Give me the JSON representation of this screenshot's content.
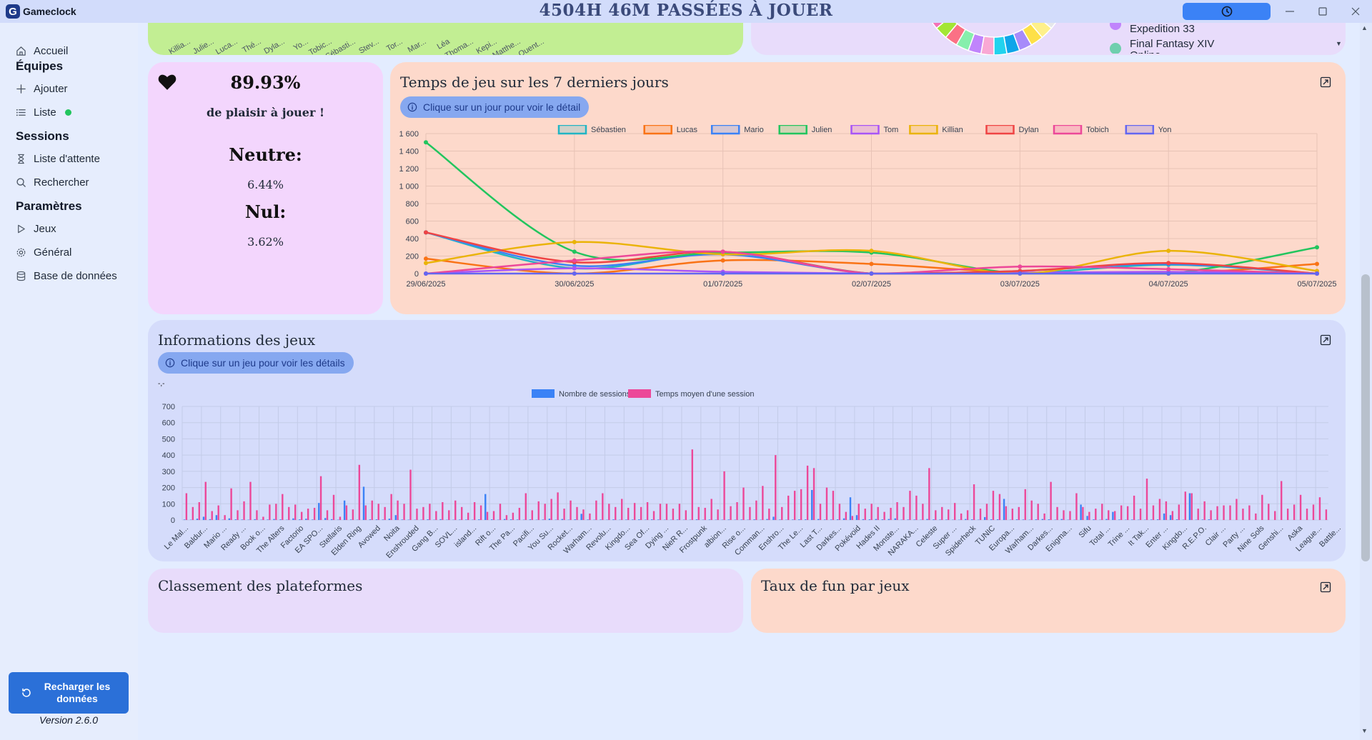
{
  "app": {
    "name": "Gameclock",
    "logo_letter": "G",
    "headline": "4504H 46M PASSÉES À JOUER"
  },
  "window": {
    "timer_icon": "clock-icon",
    "minimize": "—",
    "maximize": "☐",
    "close": "✕"
  },
  "sidebar": {
    "home": "Accueil",
    "teams_heading": "Équipes",
    "add": "Ajouter",
    "list": "Liste",
    "sessions_heading": "Sessions",
    "waitlist": "Liste d'attente",
    "search": "Rechercher",
    "settings_heading": "Paramètres",
    "games": "Jeux",
    "general": "Général",
    "database": "Base de données",
    "reload": "Recharger les données",
    "version": "Version 2.6.0"
  },
  "top_cards": {
    "names_row": [
      "Killia...",
      "Julie...",
      "Luca...",
      "Thé...",
      "Dyla...",
      "Yo...",
      "Tobic...",
      "Sébasti...",
      "Stev...",
      "Tor...",
      "Mar...",
      "Léa",
      "Thoma...",
      "Kepi...",
      "Matthe...",
      "Quent..."
    ],
    "legend_items": [
      "Expedition 33",
      "Final Fantasy XIV Online"
    ],
    "legend_colors": [
      "#c084fc",
      "#6fcfae"
    ]
  },
  "fun": {
    "percent": "89.93%",
    "caption": "de plaisir à jouer !",
    "neutral_label": "Neutre:",
    "neutral_value": "6.44%",
    "null_label": "Nul:",
    "null_value": "3.62%"
  },
  "week_chart": {
    "title": "Temps de jeu sur les 7 derniers jours",
    "hint": "Clique sur un jour pour voir le détail"
  },
  "games_chart": {
    "title": "Informations des jeux",
    "hint": "Clique sur un jeu pour voir les détails",
    "tiny_label": "-,-"
  },
  "bottom_cards": {
    "platforms_title": "Classement des plateformes",
    "fun_rate_title": "Taux de fun par jeux"
  },
  "chart_data": [
    {
      "type": "line",
      "title": "Temps de jeu sur les 7 derniers jours",
      "categories": [
        "29/06/2025",
        "30/06/2025",
        "01/07/2025",
        "02/07/2025",
        "03/07/2025",
        "04/07/2025",
        "05/07/2025"
      ],
      "ylim": [
        0,
        1600
      ],
      "yticks": [
        0,
        200,
        400,
        600,
        800,
        1000,
        1200,
        1400,
        1600
      ],
      "ytick_labels": [
        "0",
        "200",
        "400",
        "600",
        "800",
        "1 000",
        "1 200",
        "1 400",
        "1 600"
      ],
      "legend_position": "top",
      "grid": true,
      "series": [
        {
          "name": "Sébastien",
          "color": "#22b5c4",
          "values": [
            470,
            60,
            240,
            0,
            0,
            100,
            0
          ]
        },
        {
          "name": "Lucas",
          "color": "#f97316",
          "values": [
            170,
            0,
            150,
            110,
            10,
            0,
            110
          ]
        },
        {
          "name": "Mario",
          "color": "#3b82f6",
          "values": [
            470,
            90,
            220,
            0,
            30,
            110,
            0
          ]
        },
        {
          "name": "Julien",
          "color": "#22c55e",
          "values": [
            1500,
            250,
            240,
            240,
            0,
            0,
            300
          ]
        },
        {
          "name": "Tom",
          "color": "#a855f7",
          "values": [
            0,
            60,
            20,
            0,
            10,
            20,
            0
          ]
        },
        {
          "name": "Killian",
          "color": "#eab308",
          "values": [
            120,
            360,
            220,
            260,
            0,
            260,
            30
          ]
        },
        {
          "name": "Dylan",
          "color": "#ef4444",
          "values": [
            470,
            130,
            250,
            0,
            30,
            120,
            0
          ]
        },
        {
          "name": "Tobich",
          "color": "#ec4899",
          "values": [
            0,
            150,
            250,
            0,
            80,
            50,
            0
          ]
        },
        {
          "name": "Yon",
          "color": "#6366f1",
          "values": [
            0,
            0,
            0,
            0,
            0,
            0,
            0
          ]
        }
      ]
    },
    {
      "type": "bar",
      "title": "Informations des jeux",
      "ylim": [
        0,
        700
      ],
      "yticks": [
        0,
        100,
        200,
        300,
        400,
        500,
        600,
        700
      ],
      "legend_position": "top",
      "grid": true,
      "tick_labels": [
        "Le Mal...",
        "Baldur...",
        "Mario ...",
        "Ready ...",
        "Book o...",
        "The Alters",
        "Factorio",
        "EA SPO...",
        "Stellaris",
        "Elden Ring",
        "Avowed",
        "Noita",
        "Enshrouded",
        "Gang B...",
        "SOVL...",
        "island...",
        "Rift o...",
        "The Pa...",
        "Pacifi...",
        "You Su...",
        "Rocket...",
        "Warham...",
        "Revolu...",
        "Kingdo...",
        "Sea Of...",
        "Dying ...",
        "NieR R...",
        "Frostpunk",
        "albion...",
        "Rise o...",
        "Comman...",
        "Enshro...",
        "The Le...",
        "Last T...",
        "Darkes...",
        "Pokévoid",
        "Hades II",
        "Monste...",
        "NARAKA...",
        "Celeste",
        "Super ...",
        "Spiderheck",
        "TUNIC",
        "Europa...",
        "Warham...",
        "Darkes...",
        "Enigma...",
        "Sifu",
        "Total ...",
        "Trine ...",
        "It Tak...",
        "Enter ...",
        "Kingdo...",
        "R.E.P.O.",
        "Clair ...",
        "Party ...",
        "Nine Sols",
        "Genshi...",
        "Aska",
        "League...",
        "Battle..."
      ],
      "series": [
        {
          "name": "Nombre de sessions",
          "color": "#3b82f6",
          "values": [
            3,
            2,
            8,
            20,
            5,
            30,
            2,
            10,
            4,
            3,
            2,
            5,
            2,
            3,
            6,
            4,
            2,
            10,
            4,
            8,
            3,
            105,
            12,
            5,
            2,
            120,
            3,
            2,
            205,
            4,
            4,
            3,
            8,
            30,
            3,
            2,
            2,
            2,
            4,
            2,
            5,
            2,
            2,
            3,
            3,
            2,
            4,
            160,
            4,
            2,
            6,
            4,
            3,
            2,
            4,
            2,
            3,
            8,
            2,
            6,
            2,
            4,
            38,
            3,
            2,
            3,
            2,
            4,
            2,
            3,
            3,
            4,
            2,
            4,
            3,
            2,
            2,
            3,
            2,
            2,
            4,
            2,
            3,
            2,
            2,
            3,
            2,
            3,
            2,
            4,
            2,
            6,
            20,
            3,
            2,
            3,
            4,
            4,
            185,
            6,
            3,
            3,
            4,
            10,
            140,
            30,
            5,
            4,
            6,
            4,
            6,
            10,
            2,
            3,
            3,
            2,
            6,
            4,
            3,
            3,
            2,
            2,
            6,
            4,
            2,
            18,
            4,
            4,
            130,
            2,
            4,
            3,
            2,
            4,
            6,
            4,
            2,
            6,
            2,
            2,
            95,
            25,
            4,
            2,
            6,
            50,
            3,
            2,
            3,
            2,
            2,
            3,
            4,
            40,
            30,
            4,
            2,
            165,
            2,
            3,
            4,
            3
          ]
        },
        {
          "name": "Temps moyen d'une session",
          "color": "#ec4899",
          "values": [
            165,
            80,
            110,
            235,
            55,
            90,
            30,
            195,
            60,
            115,
            235,
            60,
            20,
            95,
            100,
            160,
            80,
            95,
            50,
            70,
            75,
            270,
            60,
            155,
            20,
            90,
            65,
            340,
            90,
            120,
            100,
            80,
            160,
            120,
            100,
            310,
            70,
            80,
            100,
            55,
            110,
            60,
            120,
            80,
            45,
            110,
            90,
            50,
            55,
            100,
            30,
            45,
            75,
            165,
            60,
            115,
            100,
            130,
            170,
            70,
            120,
            80,
            65,
            40,
            120,
            165,
            100,
            80,
            130,
            75,
            105,
            80,
            110,
            55,
            100,
            100,
            70,
            100,
            60,
            435,
            80,
            75,
            130,
            65,
            300,
            85,
            110,
            200,
            80,
            120,
            210,
            70,
            400,
            80,
            150,
            180,
            190,
            335,
            320,
            100,
            200,
            180,
            100,
            50,
            25,
            100,
            70,
            100,
            80,
            50,
            75,
            110,
            80,
            180,
            150,
            100,
            320,
            60,
            80,
            65,
            105,
            40,
            60,
            220,
            70,
            100,
            180,
            160,
            85,
            70,
            80,
            190,
            120,
            100,
            40,
            235,
            80,
            60,
            55,
            165,
            80,
            50,
            70,
            100,
            60,
            55,
            90,
            85,
            150,
            70,
            255,
            90,
            130,
            115,
            55,
            95,
            175,
            165,
            70,
            115,
            60,
            85,
            90,
            90,
            130,
            70,
            90,
            40,
            155,
            100,
            55,
            240,
            70,
            95,
            155,
            70,
            95,
            140,
            65
          ]
        }
      ]
    }
  ]
}
